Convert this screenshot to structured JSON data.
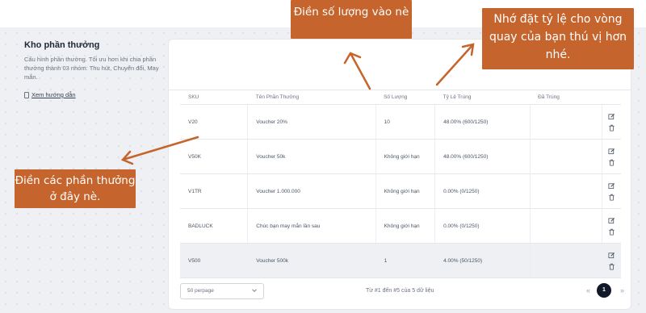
{
  "sidebar": {
    "title": "Kho phần thưởng",
    "description": "Cấu hình phần thưởng. Tối ưu hơn khi chia phần thưởng thành 03 nhóm: Thu hút, Chuyển đổi, May mắn.",
    "guide_link": "Xem hướng dẫn"
  },
  "table": {
    "columns": [
      "SKU",
      "Tên Phần Thưởng",
      "Số Lượng",
      "Tỷ Lệ Trúng",
      "Đã Trúng"
    ],
    "rows": [
      {
        "sku": "V20",
        "name": "Voucher 20%",
        "quantity": "10",
        "rate": "48.00% (600/1250)",
        "won": ""
      },
      {
        "sku": "V50K",
        "name": "Voucher 50k",
        "quantity": "Không giới hạn",
        "rate": "48.00% (600/1250)",
        "won": ""
      },
      {
        "sku": "V1TR",
        "name": "Voucher 1.000.000",
        "quantity": "Không giới hạn",
        "rate": "0.00% (0/1250)",
        "won": ""
      },
      {
        "sku": "BADLUCK",
        "name": "Chúc bạn may mắn lần sau",
        "quantity": "Không giới hạn",
        "rate": "0.00% (0/1250)",
        "won": ""
      },
      {
        "sku": "V500",
        "name": "Voucher 500k",
        "quantity": "1",
        "rate": "4.00% (50/1250)",
        "won": ""
      }
    ]
  },
  "footer": {
    "perpage": "50 perpage",
    "page_info": "Từ #1 đến #5 của 5 dữ liệu",
    "current_page": "1",
    "prev": "«",
    "next": "»"
  },
  "callouts": {
    "quantity": "Điền số lượng vào nè",
    "rate": "Nhớ đặt tỷ lệ cho vòng quay của bạn thú vị hơn nhé.",
    "rewards": "Điền các phần thưởng ở đây nè."
  },
  "colors": {
    "callout_bg": "#c5642c",
    "highlight_row": "#eef0f4",
    "active_page": "#111827"
  },
  "icons": {
    "edit": "edit-icon",
    "delete": "trash-icon",
    "guide": "document-icon",
    "dropdown": "chevron-down-icon"
  }
}
